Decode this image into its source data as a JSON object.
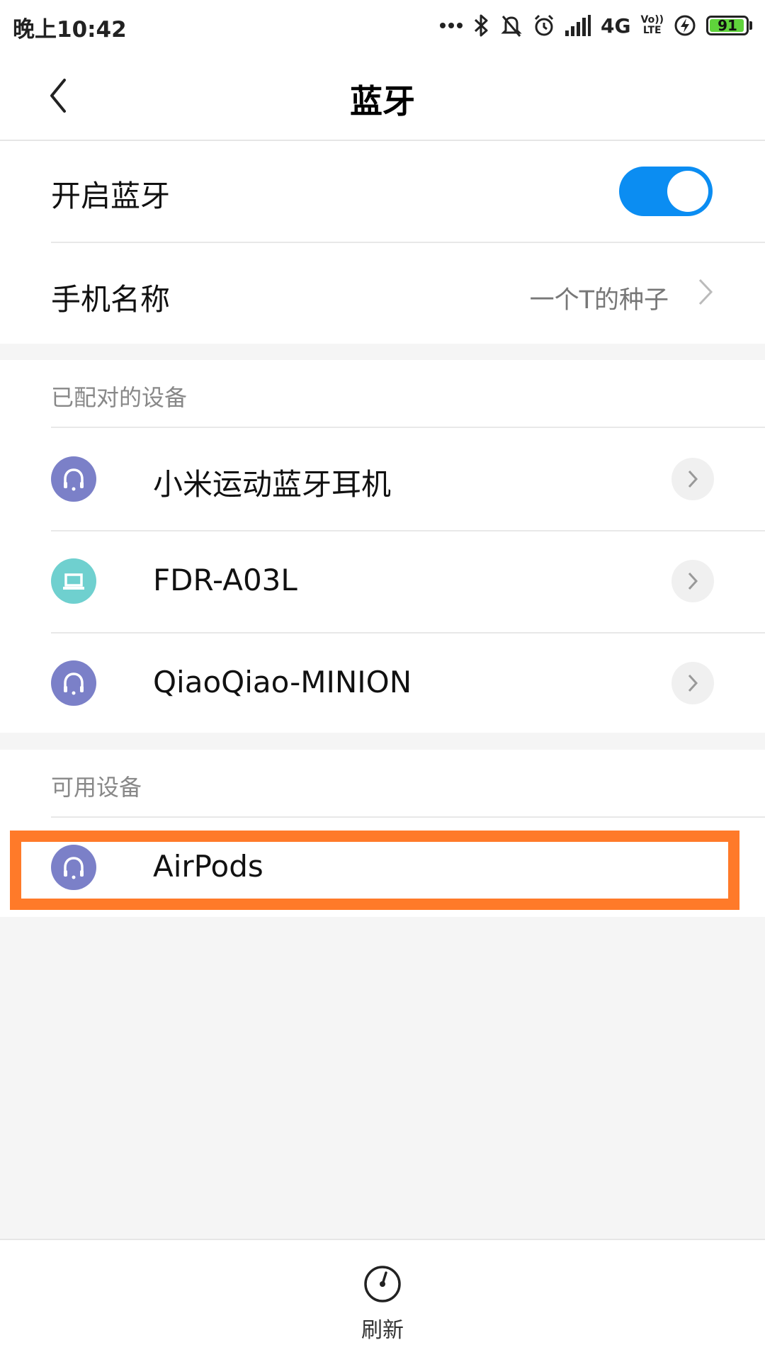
{
  "status_bar": {
    "time": "晚上10:42",
    "network": "4G",
    "volte_top": "Vo))",
    "volte_bottom": "LTE",
    "battery": "91"
  },
  "header": {
    "title": "蓝牙"
  },
  "settings": {
    "bluetooth_label": "开启蓝牙",
    "bluetooth_on": true,
    "phone_name_label": "手机名称",
    "phone_name_value": "一个T的种子"
  },
  "paired": {
    "header": "已配对的设备",
    "devices": [
      {
        "name": "小米运动蓝牙耳机",
        "icon": "headset-icon"
      },
      {
        "name": "FDR-A03L",
        "icon": "laptop-icon"
      },
      {
        "name": "QiaoQiao-MINION",
        "icon": "headset-icon"
      }
    ]
  },
  "available": {
    "header": "可用设备",
    "devices": [
      {
        "name": "AirPods",
        "icon": "headset-icon"
      }
    ]
  },
  "bottom": {
    "refresh_label": "刷新"
  },
  "colors": {
    "accent": "#0b8df2",
    "headset_icon_bg": "#7b80c8",
    "laptop_icon_bg": "#6fd0cf",
    "highlight": "#ff7a29"
  }
}
